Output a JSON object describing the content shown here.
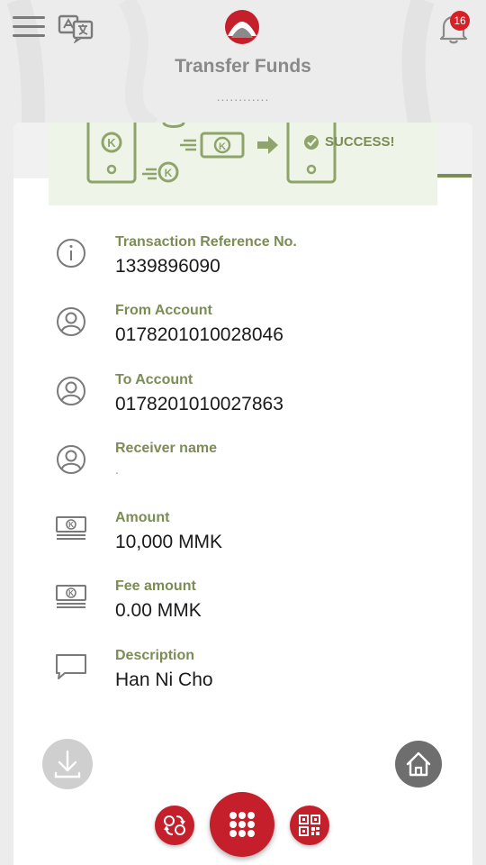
{
  "header": {
    "title": "Transfer Funds",
    "dots": "............",
    "notification_count": "16"
  },
  "banner": {
    "status_text": "SUCCESS!",
    "currency_symbol": "K"
  },
  "details": [
    {
      "icon": "info-icon",
      "label": "Transaction Reference No.",
      "value": "1339896090"
    },
    {
      "icon": "user-circle-icon",
      "label": "From Account",
      "value": "0178201010028046"
    },
    {
      "icon": "user-circle-icon",
      "label": "To Account",
      "value": "0178201010027863"
    },
    {
      "icon": "user-circle-icon",
      "label": "Receiver name",
      "value": "."
    },
    {
      "icon": "banknote-icon",
      "label": "Amount",
      "value": "10,000 MMK"
    },
    {
      "icon": "banknote-icon",
      "label": "Fee amount",
      "value": "0.00 MMK"
    },
    {
      "icon": "chat-bubble-icon",
      "label": "Description",
      "value": "Han Ni Cho"
    }
  ],
  "icons": {
    "menu": "hamburger-menu-icon",
    "language": "translate-icon",
    "logo": "bank-logo",
    "notifications": "bell-icon",
    "download": "download-icon",
    "home": "home-icon",
    "exchange": "exchange-icon",
    "apps": "grid-icon",
    "qr": "qr-code-icon"
  },
  "colors": {
    "accent_green": "#7b8c55",
    "brand_red": "#c41f2a",
    "badge_red": "#d81f26",
    "background": "#ececec"
  }
}
